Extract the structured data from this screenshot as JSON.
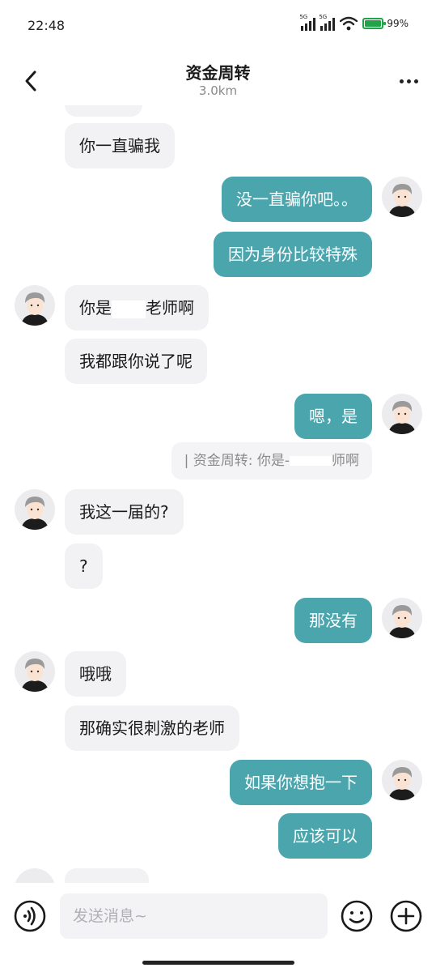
{
  "status_bar": {
    "time": "22:48",
    "signal_1_label": "5G",
    "signal_2_label": "5G",
    "battery_level": 0.99,
    "battery_text": "99%"
  },
  "header": {
    "title": "资金周转",
    "subtitle": "3.0km",
    "back_icon": "chevron-left-icon",
    "more_icon": "more-dots-icon"
  },
  "messages": [
    {
      "side": "left",
      "text": "你一直骗我"
    },
    {
      "side": "right",
      "text": "没一直骗你吧。。"
    },
    {
      "side": "right",
      "text": "因为身份比较特殊"
    },
    {
      "side": "left",
      "text_before": "你是",
      "text_after": "老师啊"
    },
    {
      "side": "left",
      "text": "我都跟你说了呢"
    },
    {
      "side": "right",
      "text": "嗯，是"
    },
    {
      "quote_before": "| 资金周转: 你是-",
      "quote_after": "师啊"
    },
    {
      "side": "left",
      "text": "我这一届的?"
    },
    {
      "side": "left",
      "text": "?"
    },
    {
      "side": "right",
      "text": "那没有"
    },
    {
      "side": "left",
      "text": "哦哦"
    },
    {
      "side": "left",
      "text": "那确实很刺激的老师"
    },
    {
      "side": "right",
      "text": "如果你想抱一下"
    },
    {
      "side": "right",
      "text": "应该可以"
    }
  ],
  "input_bar": {
    "placeholder": "发送消息~",
    "voice_icon": "voice-icon",
    "emoji_icon": "emoji-icon",
    "add_icon": "plus-circle-icon"
  },
  "colors": {
    "right_bubble": "#4aa5ad",
    "left_bubble": "#f2f2f5",
    "battery": "#21a34a"
  }
}
